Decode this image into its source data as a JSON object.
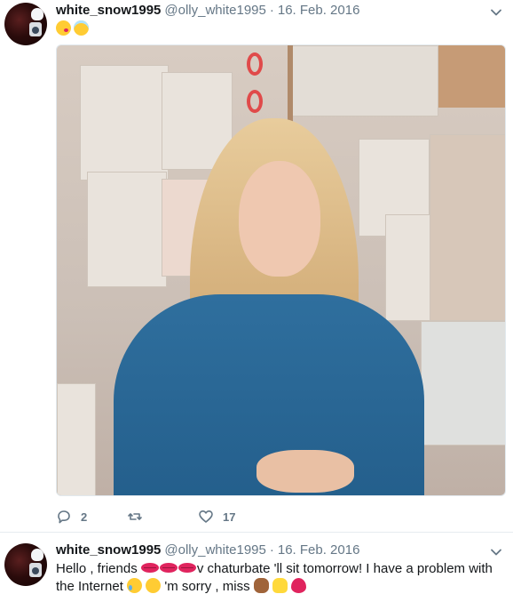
{
  "tweets": [
    {
      "display_name": "white_snow1995",
      "handle": "@olly_white1995",
      "separator": "·",
      "date": "16. Feb. 2016",
      "emojis": [
        "face-blowing-kiss",
        "smiling-face-with-halo"
      ],
      "actions": {
        "reply_count": "2",
        "retweet_count": "",
        "like_count": "17"
      }
    },
    {
      "display_name": "white_snow1995",
      "handle": "@olly_white1995",
      "separator": "·",
      "date": "16. Feb. 2016",
      "text": {
        "part1": "Hello , friends ",
        "part2": "v chaturbate 'll sit tomorrow! I have a problem with the Internet ",
        "part3": " 'm sorry , miss "
      }
    }
  ],
  "colors": {
    "accent": "#1da1f2",
    "secondary_text": "#657786",
    "primary_text": "#14171a",
    "divider": "#e6ecf0"
  }
}
